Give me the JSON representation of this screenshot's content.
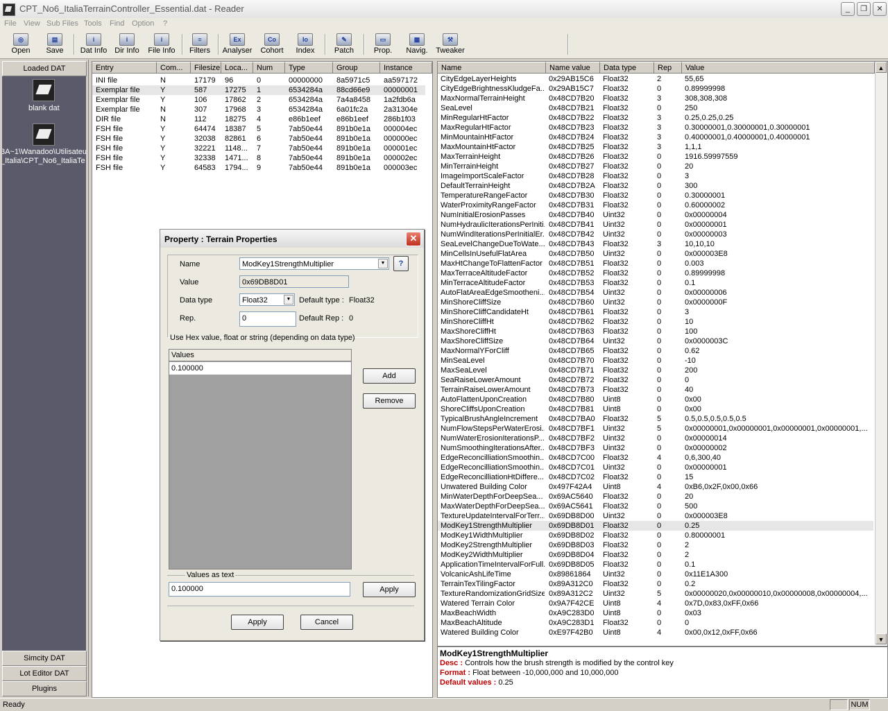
{
  "window": {
    "title": "CPT_No6_ItaliaTerrainController_Essential.dat - Reader"
  },
  "menu": [
    "File",
    "View",
    "Sub Files",
    "Tools",
    "Find",
    "Option",
    "?"
  ],
  "toolbar": [
    {
      "label": "Open",
      "icon": "open-icon",
      "glyph": "◎"
    },
    {
      "label": "Save",
      "icon": "save-icon",
      "glyph": "▤"
    },
    {
      "label": "Dat Info",
      "icon": "dat-info-icon",
      "glyph": "i"
    },
    {
      "label": "Dir Info",
      "icon": "dir-info-icon",
      "glyph": "i"
    },
    {
      "label": "File Info",
      "icon": "file-info-icon",
      "glyph": "i"
    },
    {
      "label": "Filters",
      "icon": "filters-icon",
      "glyph": "≡"
    },
    {
      "label": "Analyser",
      "icon": "analyser-icon",
      "glyph": "Ex"
    },
    {
      "label": "Cohort",
      "icon": "cohort-icon",
      "glyph": "Co"
    },
    {
      "label": "Index",
      "icon": "index-icon",
      "glyph": "Io"
    },
    {
      "label": "Patch",
      "icon": "patch-icon",
      "glyph": "✎"
    },
    {
      "label": "Prop.",
      "icon": "properties-icon",
      "glyph": "▭"
    },
    {
      "label": "Navig.",
      "icon": "navigator-icon",
      "glyph": "▦"
    },
    {
      "label": "Tweaker",
      "icon": "tweaker-icon",
      "glyph": "⚒"
    }
  ],
  "left": {
    "header": "Loaded DAT",
    "items": [
      {
        "label": "blank dat"
      },
      {
        "label_line1": "3A~1\\Wanadoo\\Utilisateu",
        "label_line2": "_Italia\\CPT_No6_ItaliaTe"
      }
    ],
    "bottom": [
      "Simcity DAT",
      "Lot Editor DAT",
      "Plugins"
    ]
  },
  "entries": {
    "columns": [
      "Entry",
      "Com...",
      "Filesize",
      "Loca...",
      "Num",
      "Type",
      "Group",
      "Instance"
    ],
    "rows": [
      [
        "INI file",
        "N",
        "17179",
        "96",
        "0",
        "00000000",
        "8a5971c5",
        "aa597172"
      ],
      [
        "Exemplar file",
        "Y",
        "587",
        "17275",
        "1",
        "6534284a",
        "88cd66e9",
        "00000001"
      ],
      [
        "Exemplar file",
        "Y",
        "106",
        "17862",
        "2",
        "6534284a",
        "7a4a8458",
        "1a2fdb6a"
      ],
      [
        "Exemplar file",
        "N",
        "307",
        "17968",
        "3",
        "6534284a",
        "6a01fc2a",
        "2a31304e"
      ],
      [
        "DIR file",
        "N",
        "112",
        "18275",
        "4",
        "e86b1eef",
        "e86b1eef",
        "286b1f03"
      ],
      [
        "FSH file",
        "Y",
        "64474",
        "18387",
        "5",
        "7ab50e44",
        "891b0e1a",
        "000004ec"
      ],
      [
        "FSH file",
        "Y",
        "32038",
        "82861",
        "6",
        "7ab50e44",
        "891b0e1a",
        "000000ec"
      ],
      [
        "FSH file",
        "Y",
        "32221",
        "1148...",
        "7",
        "7ab50e44",
        "891b0e1a",
        "000001ec"
      ],
      [
        "FSH file",
        "Y",
        "32338",
        "1471...",
        "8",
        "7ab50e44",
        "891b0e1a",
        "000002ec"
      ],
      [
        "FSH file",
        "Y",
        "64583",
        "1794...",
        "9",
        "7ab50e44",
        "891b0e1a",
        "000003ec"
      ]
    ],
    "selected_row": 1
  },
  "properties": {
    "columns": [
      "Name",
      "Name value",
      "Data type",
      "Rep",
      "Value"
    ],
    "selected_row": 46,
    "rows": [
      [
        "CityEdgeLayerHeights",
        "0x29AB15C6",
        "Float32",
        "2",
        "55,65"
      ],
      [
        "CityEdgeBrightnessKludgeFa...",
        "0x29AB15C7",
        "Float32",
        "0",
        "0.89999998"
      ],
      [
        "MaxNormalTerrainHeight",
        "0x48CD7B20",
        "Float32",
        "3",
        "308,308,308"
      ],
      [
        "SeaLevel",
        "0x48CD7B21",
        "Float32",
        "0",
        "250"
      ],
      [
        "MinRegularHtFactor",
        "0x48CD7B22",
        "Float32",
        "3",
        "0.25,0.25,0.25"
      ],
      [
        "MaxRegularHtFactor",
        "0x48CD7B23",
        "Float32",
        "3",
        "0.30000001,0.30000001,0.30000001"
      ],
      [
        "MinMountainHtFactor",
        "0x48CD7B24",
        "Float32",
        "3",
        "0.40000001,0.40000001,0.40000001"
      ],
      [
        "MaxMountainHtFactor",
        "0x48CD7B25",
        "Float32",
        "3",
        "1,1,1"
      ],
      [
        "MaxTerrainHeight",
        "0x48CD7B26",
        "Float32",
        "0",
        "1916.59997559"
      ],
      [
        "MinTerrainHeight",
        "0x48CD7B27",
        "Float32",
        "0",
        "20"
      ],
      [
        "ImageImportScaleFactor",
        "0x48CD7B28",
        "Float32",
        "0",
        "3"
      ],
      [
        "DefaultTerrainHeight",
        "0x48CD7B2A",
        "Float32",
        "0",
        "300"
      ],
      [
        "TemperatureRangeFactor",
        "0x48CD7B30",
        "Float32",
        "0",
        "0.30000001"
      ],
      [
        "WaterProximityRangeFactor",
        "0x48CD7B31",
        "Float32",
        "0",
        "0.60000002"
      ],
      [
        "NumInitialErosionPasses",
        "0x48CD7B40",
        "Uint32",
        "0",
        "0x00000004"
      ],
      [
        "NumHydraulicIterationsPerIniti...",
        "0x48CD7B41",
        "Uint32",
        "0",
        "0x00000001"
      ],
      [
        "NumWindIterationsPerInitialEr...",
        "0x48CD7B42",
        "Uint32",
        "0",
        "0x00000003"
      ],
      [
        "SeaLevelChangeDueToWate...",
        "0x48CD7B43",
        "Float32",
        "3",
        "10,10,10"
      ],
      [
        "MinCellsInUsefulFlatArea",
        "0x48CD7B50",
        "Uint32",
        "0",
        "0x000003E8"
      ],
      [
        "MaxHtChangeToFlattenFactor",
        "0x48CD7B51",
        "Float32",
        "0",
        "0.003"
      ],
      [
        "MaxTerraceAltitudeFactor",
        "0x48CD7B52",
        "Float32",
        "0",
        "0.89999998"
      ],
      [
        "MinTerraceAltitudeFactor",
        "0x48CD7B53",
        "Float32",
        "0",
        "0.1"
      ],
      [
        "AutoFlatAreaEdgeSmootheni...",
        "0x48CD7B54",
        "Uint32",
        "0",
        "0x00000006"
      ],
      [
        "MinShoreCliffSize",
        "0x48CD7B60",
        "Uint32",
        "0",
        "0x0000000F"
      ],
      [
        "MinShoreCliffCandidateHt",
        "0x48CD7B61",
        "Float32",
        "0",
        "3"
      ],
      [
        "MinShoreCliffHt",
        "0x48CD7B62",
        "Float32",
        "0",
        "10"
      ],
      [
        "MaxShoreCliffHt",
        "0x48CD7B63",
        "Float32",
        "0",
        "100"
      ],
      [
        "MaxShoreCliffSize",
        "0x48CD7B64",
        "Uint32",
        "0",
        "0x0000003C"
      ],
      [
        "MaxNormalYForCliff",
        "0x48CD7B65",
        "Float32",
        "0",
        "0.62"
      ],
      [
        "MinSeaLevel",
        "0x48CD7B70",
        "Float32",
        "0",
        "-10"
      ],
      [
        "MaxSeaLevel",
        "0x48CD7B71",
        "Float32",
        "0",
        "200"
      ],
      [
        "SeaRaiseLowerAmount",
        "0x48CD7B72",
        "Float32",
        "0",
        "0"
      ],
      [
        "TerrainRaiseLowerAmount",
        "0x48CD7B73",
        "Float32",
        "0",
        "40"
      ],
      [
        "AutoFlattenUponCreation",
        "0x48CD7B80",
        "Uint8",
        "0",
        "0x00"
      ],
      [
        "ShoreCliffsUponCreation",
        "0x48CD7B81",
        "Uint8",
        "0",
        "0x00"
      ],
      [
        "TypicalBrushAngleIncrement",
        "0x48CD7BA0",
        "Float32",
        "5",
        "0.5,0.5,0.5,0.5,0.5"
      ],
      [
        "NumFlowStepsPerWaterErosi...",
        "0x48CD7BF1",
        "Uint32",
        "5",
        "0x00000001,0x00000001,0x00000001,0x00000001,..."
      ],
      [
        "NumWaterErosionIterationsP...",
        "0x48CD7BF2",
        "Uint32",
        "0",
        "0x00000014"
      ],
      [
        "NumSmoothingIterationsAfter...",
        "0x48CD7BF3",
        "Uint32",
        "0",
        "0x00000002"
      ],
      [
        "EdgeReconcilliationSmoothin...",
        "0x48CD7C00",
        "Float32",
        "4",
        "0,6,300,40"
      ],
      [
        "EdgeReconcilliationSmoothin...",
        "0x48CD7C01",
        "Uint32",
        "0",
        "0x00000001"
      ],
      [
        "EdgeReconcilliationHtDiffere...",
        "0x48CD7C02",
        "Float32",
        "0",
        "15"
      ],
      [
        "Unwatered Building Color",
        "0x497F42A4",
        "Uint8",
        "4",
        "0xB6,0x2F,0x00,0x66"
      ],
      [
        "MinWaterDepthForDeepSea...",
        "0x69AC5640",
        "Float32",
        "0",
        "20"
      ],
      [
        "MaxWaterDepthForDeepSea...",
        "0x69AC5641",
        "Float32",
        "0",
        "500"
      ],
      [
        "TextureUpdateIntervalForTerr...",
        "0x69DB8D00",
        "Uint32",
        "0",
        "0x000003E8"
      ],
      [
        "ModKey1StrengthMultiplier",
        "0x69DB8D01",
        "Float32",
        "0",
        "0.25"
      ],
      [
        "ModKey1WidthMultiplier",
        "0x69DB8D02",
        "Float32",
        "0",
        "0.80000001"
      ],
      [
        "ModKey2StrengthMultiplier",
        "0x69DB8D03",
        "Float32",
        "0",
        "2"
      ],
      [
        "ModKey2WidthMultiplier",
        "0x69DB8D04",
        "Float32",
        "0",
        "2"
      ],
      [
        "ApplicationTimeIntervalForFull...",
        "0x69DB8D05",
        "Float32",
        "0",
        "0.1"
      ],
      [
        "VolcanicAshLifeTime",
        "0x89861864",
        "Uint32",
        "0",
        "0x11E1A300"
      ],
      [
        "TerrainTexTilingFactor",
        "0x89A312C0",
        "Float32",
        "0",
        "0.2"
      ],
      [
        "TextureRandomizationGridSize",
        "0x89A312C2",
        "Uint32",
        "5",
        "0x00000020,0x00000010,0x00000008,0x00000004,..."
      ],
      [
        "Watered Terrain Color",
        "0x9A7F42CE",
        "Uint8",
        "4",
        "0x7D,0x83,0xFF,0x66"
      ],
      [
        "MaxBeachWidth",
        "0xA9C283D0",
        "Uint8",
        "0",
        "0x03"
      ],
      [
        "MaxBeachAltitude",
        "0xA9C283D1",
        "Float32",
        "0",
        "0"
      ],
      [
        "Watered Building Color",
        "0xE97F42B0",
        "Uint8",
        "4",
        "0x00,0x12,0xFF,0x66"
      ]
    ]
  },
  "description": {
    "title": "ModKey1StrengthMultiplier",
    "desc_label": "Desc :",
    "desc": "Controls how the brush strength is modified by the control key",
    "format_label": "Format :",
    "format": "Float between -10,000,000 and 10,000,000",
    "default_label": "Default values :",
    "default": "0.25"
  },
  "status": {
    "text": "Ready",
    "num": "NUM"
  },
  "dialog": {
    "title": "Property : Terrain Properties",
    "name_label": "Name",
    "name_value": "ModKey1StrengthMultiplier",
    "help": "?",
    "value_label": "Value",
    "value_value": "0x69DB8D01",
    "datatype_label": "Data type",
    "datatype_value": "Float32",
    "default_type_label": "Default type :",
    "default_type_value": "Float32",
    "rep_label": "Rep.",
    "rep_value": "0",
    "default_rep_label": "Default Rep :",
    "default_rep_value": "0",
    "hint": "Use Hex value, float or string (depending on data type)",
    "values_header": "Values",
    "values": [
      "0.100000"
    ],
    "add": "Add",
    "remove": "Remove",
    "values_as_text_label": "Values as text",
    "values_as_text": "0.100000",
    "apply_small": "Apply",
    "apply": "Apply",
    "cancel": "Cancel"
  }
}
